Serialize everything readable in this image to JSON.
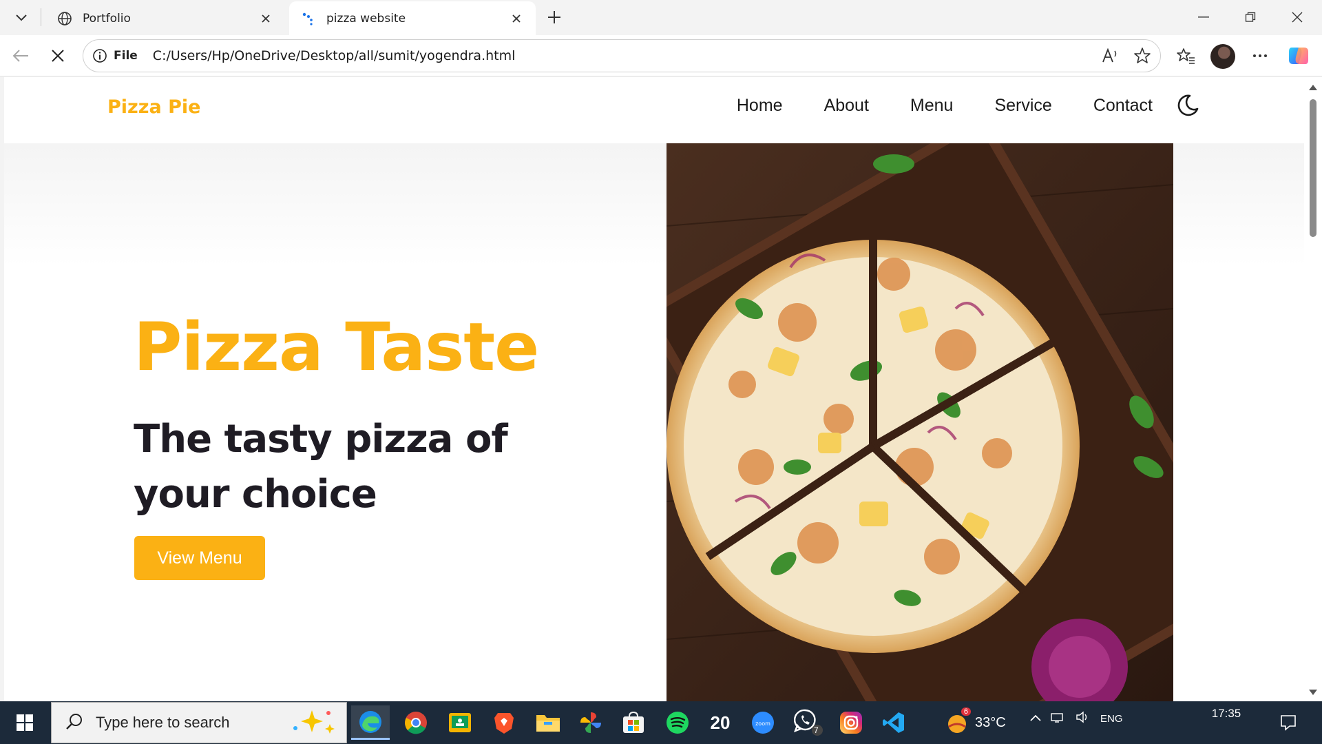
{
  "browser": {
    "tabs": [
      {
        "title": "Portfolio",
        "icon": "globe-icon"
      },
      {
        "title": "pizza website",
        "icon": "loading-icon"
      }
    ],
    "address": {
      "scheme": "File",
      "url": "C:/Users/Hp/OneDrive/Desktop/all/sumit/yogendra.html"
    }
  },
  "site": {
    "logo": "Pizza Pie",
    "nav": [
      "Home",
      "About",
      "Menu",
      "Service",
      "Contact"
    ],
    "hero": {
      "title": "Pizza Taste",
      "subtitle": "The tasty pizza of your choice",
      "cta": "View Menu"
    },
    "colors": {
      "brand": "#fbb114",
      "heading": "#1f1c24"
    }
  },
  "taskbar": {
    "search_placeholder": "Type here to search",
    "weather_temp": "33°C",
    "weather_badge": "6",
    "whatsapp_badge": "7",
    "calendar_day": "20",
    "clock_time": "17:35",
    "tray_lang": "ENG"
  }
}
